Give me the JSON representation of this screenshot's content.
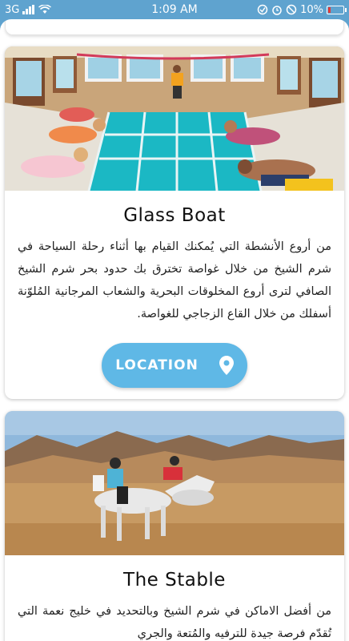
{
  "status_bar": {
    "signal_text": "3G",
    "time": "1:09 AM",
    "battery_percent": "10%"
  },
  "cards": [
    {
      "title": "Glass Boat",
      "description": "من أروع الأنشطة التي يُمكنك القيام بها أثناء رحلة السياحة في شرم الشيخ من خلال غواصة تخترق بك حدود بحر شرم الشيخ الصافي لترى أروع المخلوقات البحرية والشعاب المرجانية المُلوّنة أسفلك من خلال القاع الزجاجي للغواصة.",
      "button_label": "LOCATION",
      "button_icon": "map-pin-icon"
    },
    {
      "title": "The Stable",
      "description": "من أفضل الاماكن في شرم الشيخ وبالتحديد في خليج نعمة التي تُقدّم فرصة جيدة للترفيه والمُتعة والجري"
    }
  ],
  "colors": {
    "status_bar": "#5fa3cf",
    "button": "#5fb8e6"
  }
}
